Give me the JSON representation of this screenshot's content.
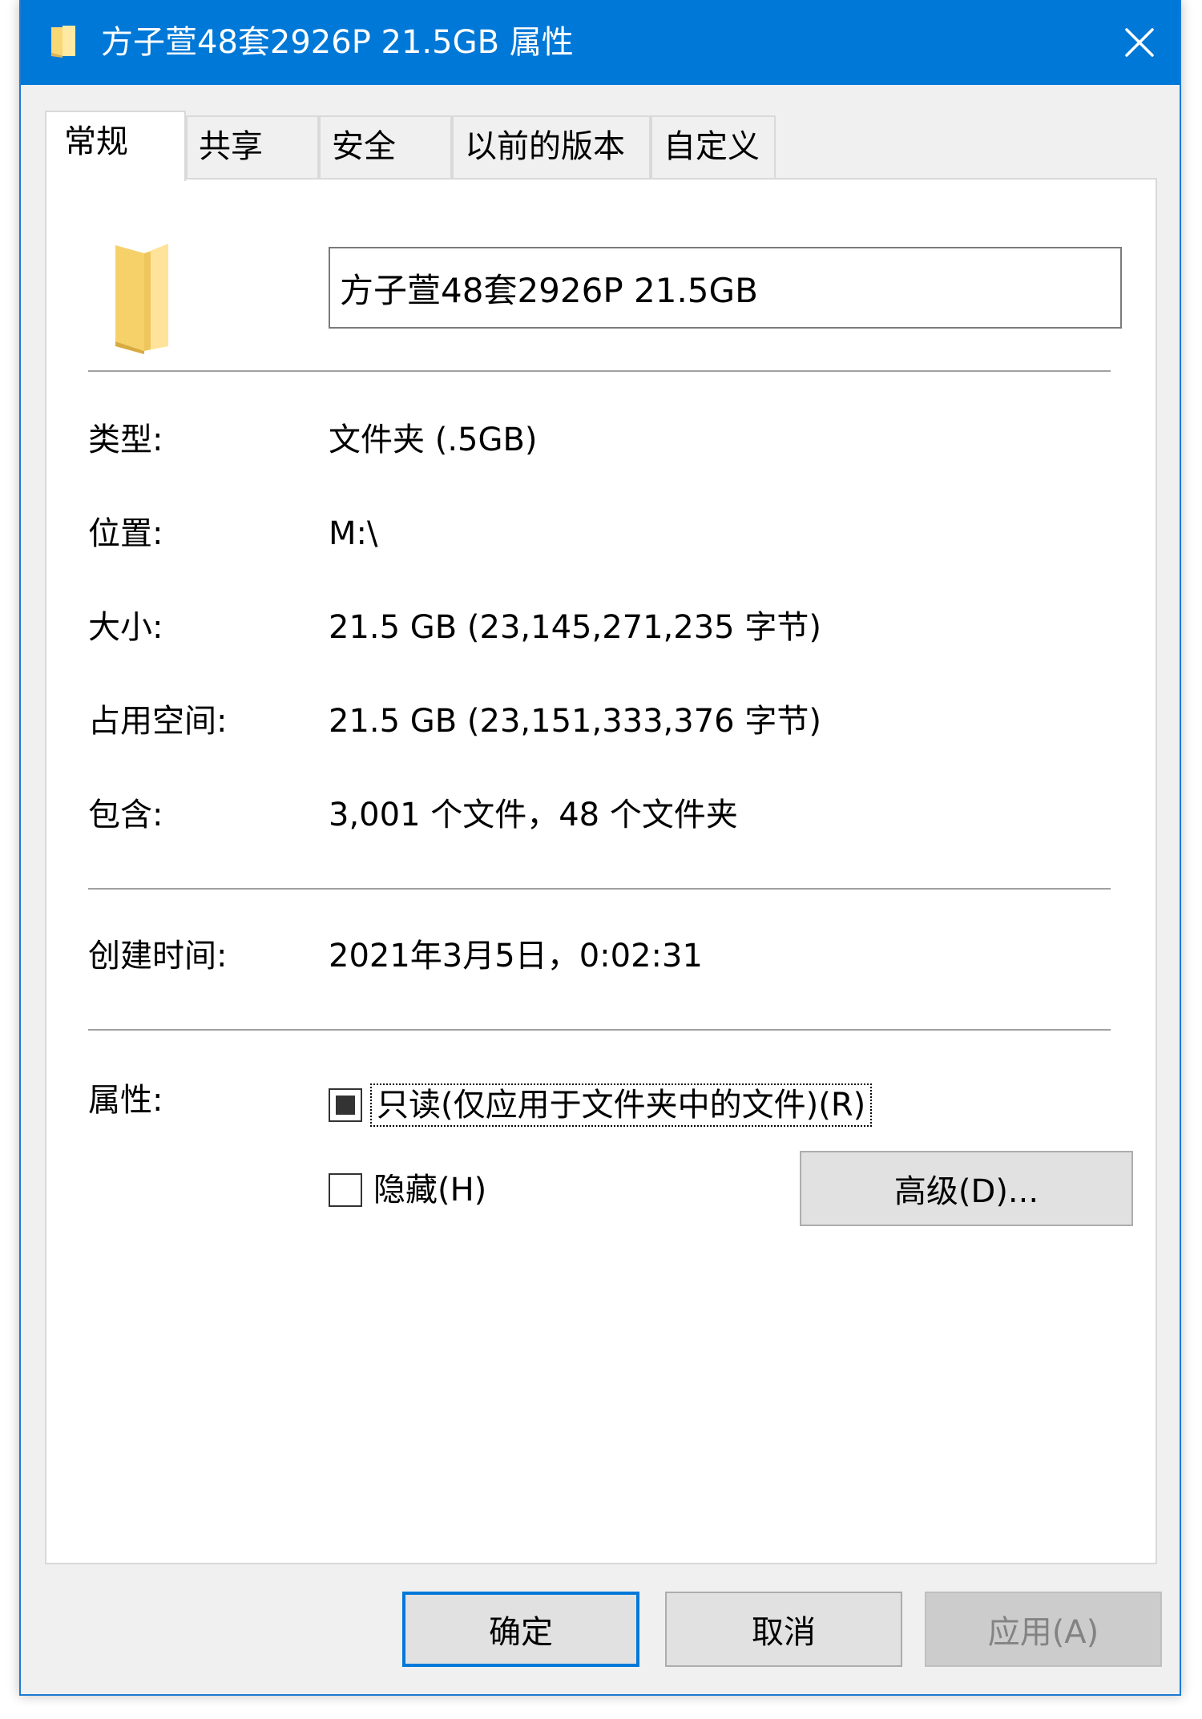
{
  "window": {
    "title": "方子萱48套2926P 21.5GB 属性",
    "close_icon": "close-icon",
    "folder_icon": "folder-icon",
    "accent": "#0078d7"
  },
  "tabs": [
    {
      "label": "常规",
      "active": true
    },
    {
      "label": "共享",
      "active": false
    },
    {
      "label": "安全",
      "active": false
    },
    {
      "label": "以前的版本",
      "active": false
    },
    {
      "label": "自定义",
      "active": false
    }
  ],
  "general": {
    "name_value": "方子萱48套2926P 21.5GB",
    "rows": [
      {
        "label": "类型:",
        "value": "文件夹 (.5GB)"
      },
      {
        "label": "位置:",
        "value": "M:\\"
      },
      {
        "label": "大小:",
        "value": "21.5 GB (23,145,271,235 字节)"
      },
      {
        "label": "占用空间:",
        "value": "21.5 GB (23,151,333,376 字节)"
      },
      {
        "label": "包含:",
        "value": "3,001 个文件，48 个文件夹"
      }
    ],
    "created": {
      "label": "创建时间:",
      "value": "2021年3月5日，0:02:31"
    },
    "attributes": {
      "label": "属性:",
      "readonly": "只读(仅应用于文件夹中的文件)(R)",
      "readonly_state": "indeterminate",
      "hidden": "隐藏(H)",
      "hidden_state": "unchecked",
      "advanced": "高级(D)..."
    }
  },
  "footer": {
    "ok": "确定",
    "cancel": "取消",
    "apply": "应用(A)"
  }
}
